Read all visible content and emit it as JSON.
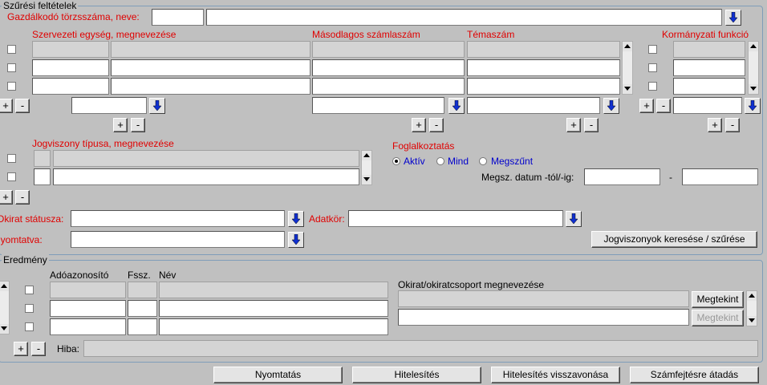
{
  "filter": {
    "legend": "Szűrési feltételek",
    "employer_label": "Gazdálkodó törzsszáma, neve:",
    "org_unit_header": "Szervezeti egység, megnevezése",
    "secondary_account_header": "Másodlagos számlaszám",
    "topic_number_header": "Témaszám",
    "gov_function_header": "Kormányzati funkció",
    "legal_relation_header": "Jogviszony típusa, megnevezése",
    "employment_label": "Foglalkoztatás",
    "radio_active": "Aktív",
    "radio_all": "Mind",
    "radio_terminated": "Megszűnt",
    "termination_date_label": "Megsz. datum -tól/-ig:",
    "date_separator": "-",
    "document_status_label": "Okirat státusza:",
    "data_scope_label": "Adatkör:",
    "printed_label": "Nyomtatva:",
    "search_button": "Jogviszonyok keresése / szűrése",
    "plus": "+",
    "minus": "-"
  },
  "result": {
    "legend": "Eredmény",
    "tax_id_header": "Adóazonosító",
    "fssz_header": "Fssz.",
    "name_header": "Név",
    "document_group_header": "Okirat/okiratcsoport megnevezése",
    "view_button": "Megtekint",
    "view_button_disabled": "Megtekint",
    "error_label": "Hiba:"
  },
  "footer": {
    "print_button": "Nyomtatás",
    "authenticate_button": "Hitelesítés",
    "revoke_button": "Hitelesítés visszavonása",
    "payroll_button": "Számfejtésre átadás"
  },
  "colors": {
    "required_label": "#e00000",
    "radio_label": "#0000cc",
    "background": "#c0c0c0"
  }
}
